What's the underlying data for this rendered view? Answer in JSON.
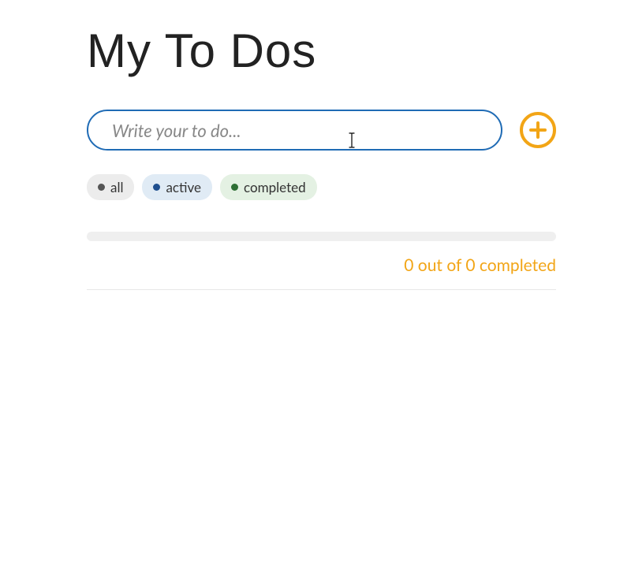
{
  "title": "My To Dos",
  "input": {
    "placeholder": "Write your to do...",
    "value": ""
  },
  "filters": {
    "all": "all",
    "active": "active",
    "completed": "completed"
  },
  "progress": {
    "completed": 0,
    "total": 0,
    "summary": "0 out of 0 completed"
  },
  "colors": {
    "accent": "#f2a516",
    "input_border": "#1f6bb5"
  }
}
